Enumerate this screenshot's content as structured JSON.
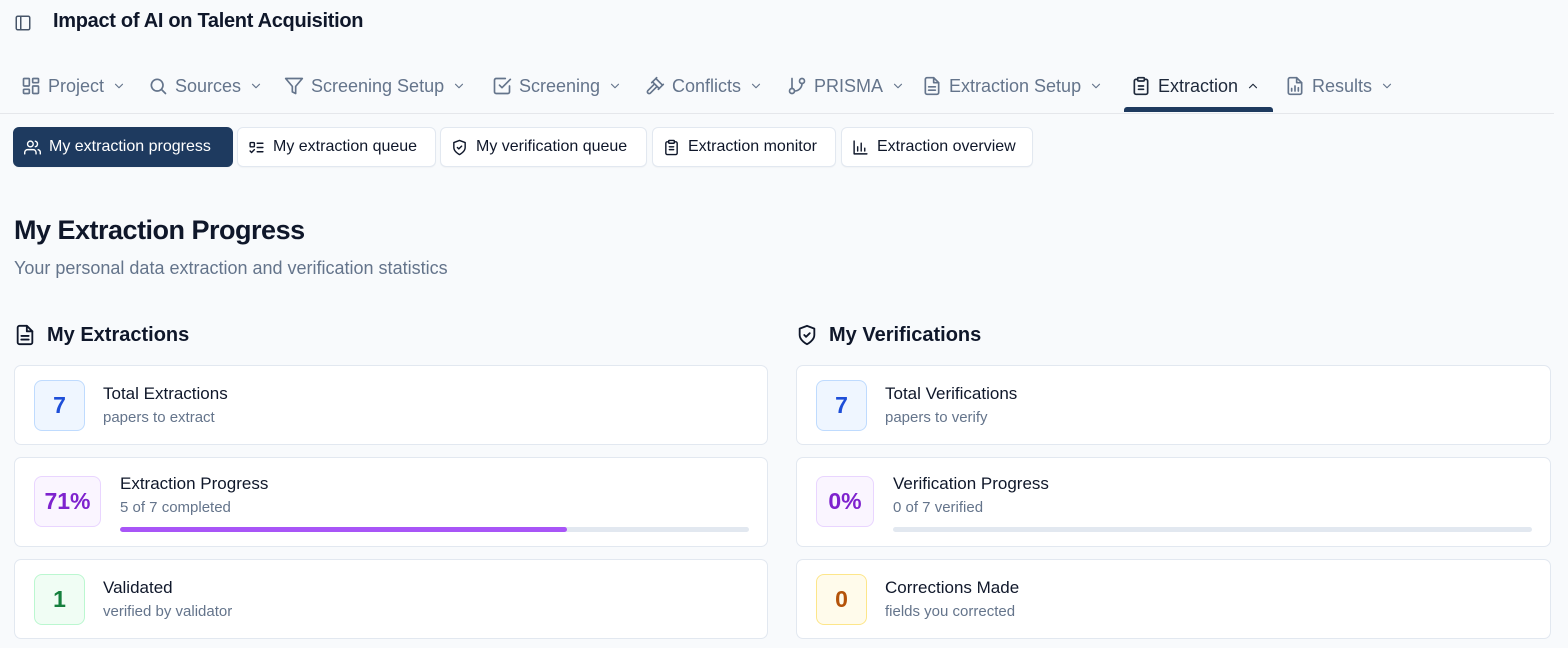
{
  "header": {
    "title": "Impact of AI on Talent Acquisition",
    "sidebar_toggle_icon": "sidebar-panel-icon"
  },
  "nav": {
    "items": [
      {
        "label": "Project",
        "icon": "grid-icon"
      },
      {
        "label": "Sources",
        "icon": "search-icon"
      },
      {
        "label": "Screening Setup",
        "icon": "filter-icon"
      },
      {
        "label": "Screening",
        "icon": "checkbox-icon"
      },
      {
        "label": "Conflicts",
        "icon": "gavel-icon"
      },
      {
        "label": "PRISMA",
        "icon": "git-branch-icon"
      },
      {
        "label": "Extraction Setup",
        "icon": "document-icon"
      },
      {
        "label": "Extraction",
        "icon": "clipboard-icon",
        "active": true
      },
      {
        "label": "Results",
        "icon": "chart-file-icon"
      }
    ]
  },
  "subtabs": [
    {
      "label": "My extraction progress",
      "icon": "users-icon",
      "active": true
    },
    {
      "label": "My extraction queue",
      "icon": "list-checks-icon"
    },
    {
      "label": "My verification queue",
      "icon": "shield-check-icon"
    },
    {
      "label": "Extraction monitor",
      "icon": "clipboard-list-icon"
    },
    {
      "label": "Extraction overview",
      "icon": "bar-chart-icon"
    }
  ],
  "page": {
    "title": "My Extraction Progress",
    "subtitle": "Your personal data extraction and verification statistics"
  },
  "extractions": {
    "heading": "My Extractions",
    "total": {
      "value": "7",
      "title": "Total Extractions",
      "sub": "papers to extract"
    },
    "progress": {
      "value": "71%",
      "title": "Extraction Progress",
      "sub": "5 of 7 completed",
      "fraction": 0.71
    },
    "validated": {
      "value": "1",
      "title": "Validated",
      "sub": "verified by validator"
    }
  },
  "verifications": {
    "heading": "My Verifications",
    "total": {
      "value": "7",
      "title": "Total Verifications",
      "sub": "papers to verify"
    },
    "progress": {
      "value": "0%",
      "title": "Verification Progress",
      "sub": "0 of 7 verified",
      "fraction": 0
    },
    "corrections": {
      "value": "0",
      "title": "Corrections Made",
      "sub": "fields you corrected"
    }
  },
  "colors": {
    "primary": "#1e3a5f",
    "blue_badge": "#1d4ed8",
    "purple_badge": "#7e22ce",
    "green_badge": "#15803d",
    "amber_badge": "#b45309",
    "progress_fill": "#a855f7"
  }
}
